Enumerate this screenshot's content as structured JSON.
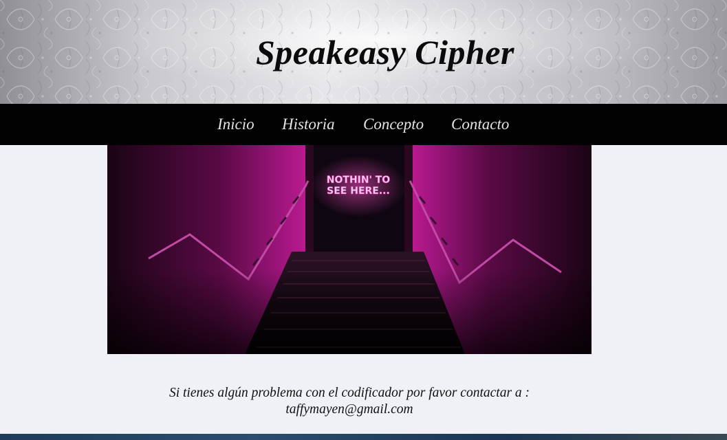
{
  "site": {
    "title": "Speakeasy Cipher"
  },
  "nav": {
    "items": [
      {
        "label": "Inicio"
      },
      {
        "label": "Historia"
      },
      {
        "label": "Concepto"
      },
      {
        "label": "Contacto"
      }
    ]
  },
  "hero": {
    "neon_sign_line1": "NOTHIN' TO",
    "neon_sign_line2": "SEE HERE..."
  },
  "contact": {
    "message": "Si tienes algún problema con el codificador por favor contactar a :",
    "email": "taffymayen@gmail.com"
  },
  "colors": {
    "nav_background": "#020202",
    "page_background": "#f0f0f7",
    "neon_pink": "#ff3fc0"
  }
}
